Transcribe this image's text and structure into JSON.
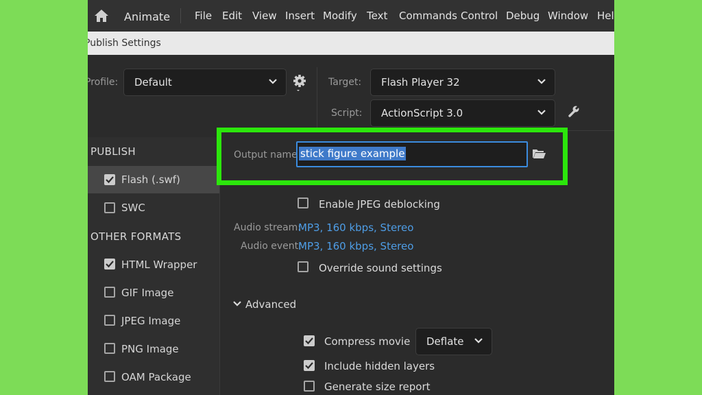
{
  "menubar": {
    "app_name": "Animate",
    "items": [
      "File",
      "Edit",
      "View",
      "Insert",
      "Modify",
      "Text",
      "Commands",
      "Control",
      "Debug",
      "Window",
      "Help"
    ]
  },
  "dialog": {
    "title": "Publish Settings"
  },
  "profile": {
    "label": "Profile:",
    "value": "Default"
  },
  "target": {
    "label": "Target:",
    "value": "Flash Player 32"
  },
  "script": {
    "label": "Script:",
    "value": "ActionScript 3.0"
  },
  "sidebar": {
    "publish_header": "PUBLISH",
    "publish_items": [
      {
        "label": "Flash (.swf)",
        "checked": true,
        "selected": true
      },
      {
        "label": "SWC",
        "checked": false,
        "selected": false
      }
    ],
    "other_header": "OTHER FORMATS",
    "other_items": [
      {
        "label": "HTML Wrapper",
        "checked": true
      },
      {
        "label": "GIF Image",
        "checked": false
      },
      {
        "label": "JPEG Image",
        "checked": false
      },
      {
        "label": "PNG Image",
        "checked": false
      },
      {
        "label": "OAM Package",
        "checked": false
      }
    ]
  },
  "output": {
    "label": "Output name:",
    "value": "stick figure example"
  },
  "jpeg_deblocking": {
    "label": "Enable JPEG deblocking",
    "checked": false
  },
  "audio_stream": {
    "label": "Audio stream:",
    "value": "MP3, 160 kbps, Stereo"
  },
  "audio_event": {
    "label": "Audio event:",
    "value": "MP3, 160 kbps, Stereo"
  },
  "override_sound": {
    "label": "Override sound settings",
    "checked": false
  },
  "advanced": {
    "label": "Advanced",
    "compress": {
      "label": "Compress movie",
      "checked": true,
      "method": "Deflate"
    },
    "hidden_layers": {
      "label": "Include hidden layers",
      "checked": true
    },
    "size_report": {
      "label": "Generate size report",
      "checked": false
    }
  },
  "colors": {
    "highlight": "#2ce60c",
    "link": "#4e9de6",
    "selection": "#3f7ac9"
  }
}
